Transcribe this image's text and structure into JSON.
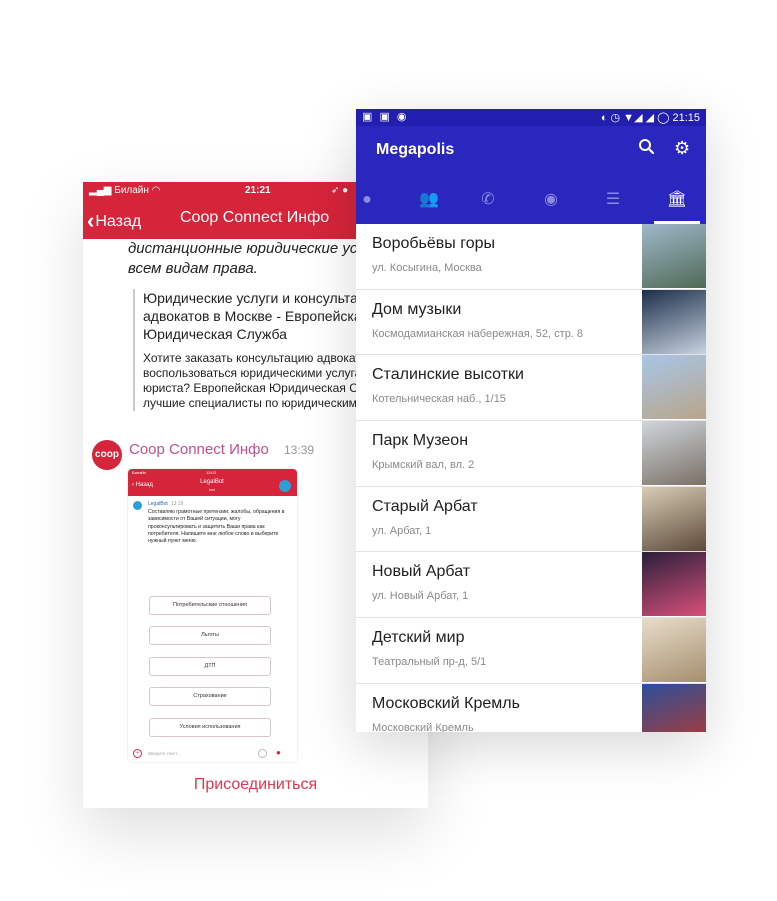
{
  "ios_app": {
    "status": {
      "carrier": "Билайн",
      "time": "21:21"
    },
    "nav": {
      "back_label": "Назад",
      "title": "Coop Connect Инфо"
    },
    "intro_text": "дистанционные юридические услуги по всем видам права.",
    "quote": {
      "title": "Юридические услуги и консультации адвокатов в Москве - Европейская Юридическая Служба",
      "body": "Хотите заказать консультацию адвоката или воспользоваться юридическими услугами хорошего юриста? Европейская Юридическая Служба - лучшие специалисты по юридическим делам"
    },
    "message": {
      "avatar_text": "coop",
      "sender": "Coop Connect Инфо",
      "time": "13:39"
    },
    "embedded_screenshot": {
      "status_carrier": "Билайн",
      "status_time": "13:03",
      "back_label": "Назад",
      "title": "LegalBot",
      "subtitle": "bot",
      "bot_name": "LegalBot",
      "bot_time": "13:19",
      "bot_text": "Составляю грамотные претензии, жалобы, обращения в зависимости от Вашей ситуации, могу проконсультировать и защитить Ваши права как потребителя. Напишите мне любое слово и выберите нужный пункт меню.",
      "buttons": [
        "Потребительские отношения",
        "Льготы",
        "ДТП",
        "Страхование",
        "Условия использования"
      ],
      "input_placeholder": "Введите текст..."
    },
    "join_label": "Присоединиться"
  },
  "android_app": {
    "status_time": "21:15",
    "app_title": "Megapolis",
    "icons": {
      "search": "search-icon",
      "settings": "gear-icon"
    },
    "tabs": [
      {
        "icon": "chat-icon",
        "active": false
      },
      {
        "icon": "people-icon",
        "active": false
      },
      {
        "icon": "phone-icon",
        "active": false
      },
      {
        "icon": "compass-icon",
        "active": false
      },
      {
        "icon": "list-icon",
        "active": false
      },
      {
        "icon": "museum-icon",
        "active": true
      }
    ],
    "places": [
      {
        "title": "Воробьёвы горы",
        "address": "ул. Косыгина, Москва",
        "thumb_colors": [
          "#9fb8cc",
          "#4f6a55"
        ]
      },
      {
        "title": "Дом музыки",
        "address": "Космодамианская набережная, 52, стр. 8",
        "thumb_colors": [
          "#1c2e4a",
          "#c8d3e0"
        ]
      },
      {
        "title": "Сталинские высотки",
        "address": "Котельническая наб., 1/15",
        "thumb_colors": [
          "#a7c6e6",
          "#b9a58b"
        ]
      },
      {
        "title": "Парк Музеон",
        "address": "Крымский вал, вл. 2",
        "thumb_colors": [
          "#cfd6dd",
          "#7a7065"
        ]
      },
      {
        "title": "Старый Арбат",
        "address": "ул. Арбат, 1",
        "thumb_colors": [
          "#d9cdb5",
          "#5c4a3a"
        ]
      },
      {
        "title": "Новый Арбат",
        "address": "ул. Новый Арбат, 1",
        "thumb_colors": [
          "#2a1f3a",
          "#d8507a"
        ]
      },
      {
        "title": "Детский мир",
        "address": "Театральный пр-д, 5/1",
        "thumb_colors": [
          "#e8ddcb",
          "#a58f6e"
        ]
      },
      {
        "title": "Московский Кремль",
        "address": "Московский Кремль",
        "thumb_colors": [
          "#2c4f9a",
          "#b23a2f"
        ]
      }
    ]
  },
  "colors": {
    "ios_red": "#d6243a",
    "android_primary": "#2a27be",
    "android_status": "#221fb0",
    "sender_pink": "#c44f8b"
  }
}
